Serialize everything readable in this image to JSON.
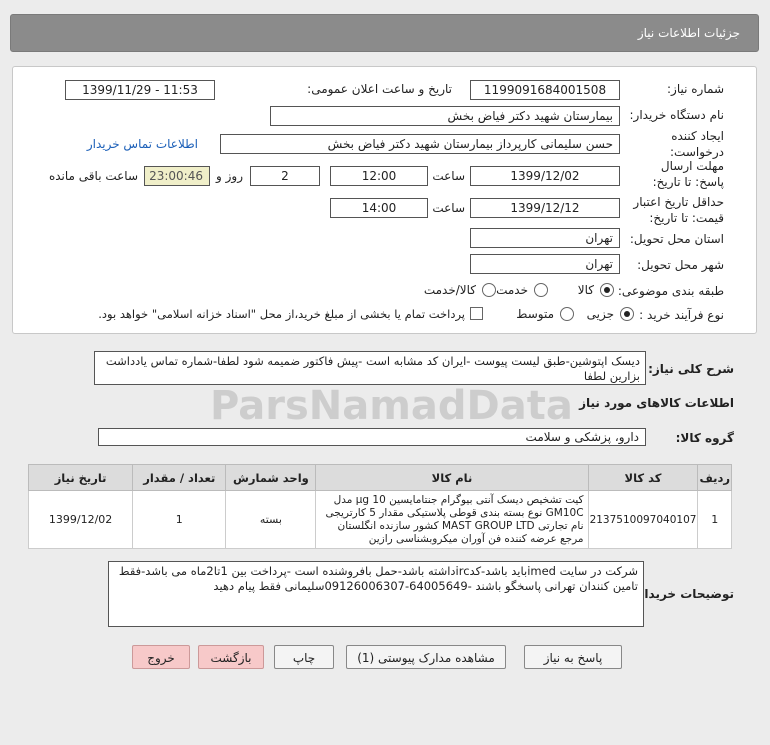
{
  "header": {
    "title": "جزئیات اطلاعات نیاز"
  },
  "form": {
    "need_number_label": "شماره نیاز:",
    "need_number": "1199091684001508",
    "announce_label": "تاریخ و ساعت اعلان عمومی:",
    "announce_value": "1399/11/29 - 11:53",
    "buyer_label": "نام دستگاه خریدار:",
    "buyer_value": "بیمارستان شهید دکتر فیاض بخش",
    "creator_label": "ایجاد کننده درخواست:",
    "creator_value": "حسن سلیمانی کارپرداز بیمارستان شهید دکتر فیاض بخش",
    "contact_link": "اطلاعات تماس خریدار",
    "deadline_label": "مهلت ارسال پاسخ: تا تاریخ:",
    "deadline_date": "1399/12/02",
    "time_label": "ساعت",
    "deadline_time": "12:00",
    "days_value": "2",
    "days_label": "روز و",
    "remaining_time": "23:00:46",
    "remaining_label": "ساعت باقی مانده",
    "price_validity_label": "حداقل تاریخ اعتبار قیمت: تا تاریخ:",
    "price_validity_date": "1399/12/12",
    "price_validity_time": "14:00",
    "province_label": "استان محل تحویل:",
    "province_value": "تهران",
    "city_label": "شهر محل تحویل:",
    "city_value": "تهران",
    "category_label": "طبقه بندی موضوعی:",
    "category_options": [
      "کالا",
      "خدمت",
      "کالا/خدمت"
    ],
    "category_selected": "کالا",
    "process_label": "نوع فرآیند خرید :",
    "process_options": [
      "جزیی",
      "متوسط"
    ],
    "process_selected": "جزیی",
    "payment_text": "پرداخت تمام یا بخشی از مبلغ خرید،از محل \"اسناد خزانه اسلامی\" خواهد بود."
  },
  "summary": {
    "label": "شرح کلی نیاز:",
    "text": "دیسک اپتوشین-طبق لیست پیوست -ایران کد مشابه است -پیش فاکتور ضمیمه شود لطفا-شماره تماس یادداشت بزارین لطفا"
  },
  "goods_info_title": "اطلاعات کالاهای مورد نیاز",
  "goods_group": {
    "label": "گروه کالا:",
    "value": "دارو، پزشکی و سلامت"
  },
  "table": {
    "headers": [
      "ردیف",
      "کد کالا",
      "نام کالا",
      "واحد شمارش",
      "تعداد / مقدار",
      "تاریخ نیاز"
    ],
    "rows": [
      {
        "index": "1",
        "code": "2137510097040107",
        "name": "کیت تشخیص دیسک آنتی بیوگرام جنتامایسین 10 µg مدل GM10C نوع بسته بندی قوطی پلاستیکی مقدار 5 کارتریجی نام تجارتی MAST GROUP LTD کشور سازنده انگلستان مرجع عرضه کننده فن آوران میکروبشناسی رازین",
        "unit": "بسته",
        "qty": "1",
        "date": "1399/12/02"
      }
    ]
  },
  "buyer_notes": {
    "label": "توضیحات خریدار:",
    "text": "شرکت در سایت imedباید باشد-کدircداشته باشد-حمل بافروشنده است -پرداخت بین 1تا2ماه می باشد-فقط تامین کنندان تهرانی پاسخگو باشند -64005649-09126006307سلیمانی فقط پیام دهید"
  },
  "buttons": {
    "reply": "پاسخ به نیاز",
    "view_docs": "مشاهده مدارک پیوستی (1)",
    "print": "چاپ",
    "back": "بازگشت",
    "exit": "خروج"
  }
}
